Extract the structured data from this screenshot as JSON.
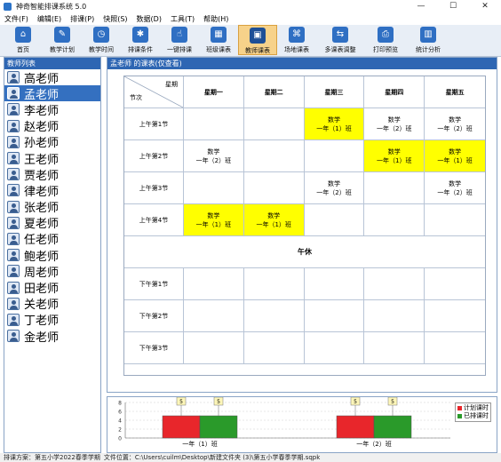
{
  "window": {
    "title": "神奇智能排课系统 5.0",
    "controls": [
      "—",
      "☐",
      "✕"
    ]
  },
  "menu": [
    "文件(F)",
    "编辑(E)",
    "排课(P)",
    "快照(S)",
    "数据(D)",
    "工具(T)",
    "帮助(H)"
  ],
  "toolbar": [
    {
      "label": "首页",
      "icon": "home-icon",
      "glyph": "⌂",
      "width": 44
    },
    {
      "label": "教学计划",
      "icon": "clipboard-icon",
      "glyph": "✎",
      "width": 44
    },
    {
      "label": "教学时间",
      "icon": "clock-icon",
      "glyph": "◷",
      "width": 44
    },
    {
      "label": "排课条件",
      "icon": "conditions-icon",
      "glyph": "✱",
      "width": 44
    },
    {
      "label": "一键排课",
      "icon": "hand-icon",
      "glyph": "☝",
      "width": 44
    },
    {
      "label": "班级课表",
      "icon": "calendar-icon",
      "glyph": "▦",
      "width": 44
    },
    {
      "label": "教师课表",
      "icon": "teacher-table-icon",
      "glyph": "▣",
      "width": 44,
      "active": true
    },
    {
      "label": "场地课表",
      "icon": "venue-icon",
      "glyph": "⌘",
      "width": 44
    },
    {
      "label": "多课表调整",
      "icon": "multi-adjust-icon",
      "glyph": "⇆",
      "width": 54
    },
    {
      "label": "打印预览",
      "icon": "printer-icon",
      "glyph": "⎙",
      "width": 48
    },
    {
      "label": "统计分析",
      "icon": "chart-icon",
      "glyph": "▥",
      "width": 48
    }
  ],
  "teacher_list": {
    "header": "教师列表",
    "teachers": [
      "高老师",
      "孟老师",
      "李老师",
      "赵老师",
      "孙老师",
      "王老师",
      "贾老师",
      "律老师",
      "张老师",
      "夏老师",
      "任老师",
      "鲍老师",
      "周老师",
      "田老师",
      "关老师",
      "丁老师",
      "金老师"
    ],
    "selected_index": 1
  },
  "schedule": {
    "panel_title": "孟老师 的课表(仅查看)",
    "corner_top": "星期",
    "corner_bottom": "节次",
    "days": [
      "星期一",
      "星期二",
      "星期三",
      "星期四",
      "星期五"
    ],
    "lunch_label": "午休",
    "periods": [
      {
        "label": "上午第1节",
        "cells": [
          null,
          null,
          {
            "line1": "数学",
            "line2": "一年（1）班",
            "highlight": true
          },
          {
            "line1": "数学",
            "line2": "一年（2）班"
          },
          {
            "line1": "数学",
            "line2": "一年（2）班"
          }
        ]
      },
      {
        "label": "上午第2节",
        "cells": [
          {
            "line1": "数学",
            "line2": "一年（2）班"
          },
          null,
          null,
          {
            "line1": "数学",
            "line2": "一年（1）班",
            "highlight": true
          },
          {
            "line1": "数学",
            "line2": "一年（1）班",
            "highlight": true
          }
        ]
      },
      {
        "label": "上午第3节",
        "cells": [
          null,
          null,
          {
            "line1": "数学",
            "line2": "一年（2）班"
          },
          null,
          {
            "line1": "数学",
            "line2": "一年（2）班"
          }
        ]
      },
      {
        "label": "上午第4节",
        "cells": [
          {
            "line1": "数学",
            "line2": "一年（1）班",
            "highlight": true
          },
          {
            "line1": "数学",
            "line2": "一年（1）班",
            "highlight": true
          },
          null,
          null,
          null
        ]
      },
      {
        "label": "下午第1节",
        "cells": [
          null,
          null,
          null,
          null,
          null
        ]
      },
      {
        "label": "下午第2节",
        "cells": [
          null,
          null,
          null,
          null,
          null
        ]
      },
      {
        "label": "下午第3节",
        "cells": [
          null,
          null,
          null,
          null,
          null
        ]
      }
    ]
  },
  "stats_chart": {
    "legend": [
      {
        "label": "计划课时",
        "color": "#e8262b"
      },
      {
        "label": "已排课时",
        "color": "#2a9a2a"
      }
    ],
    "y_ticks": [
      "8",
      "6",
      "4",
      "2",
      "0"
    ],
    "groups": [
      {
        "class": "一年（1）班",
        "planned": 5,
        "scheduled": 5
      },
      {
        "class": "一年（2）班",
        "planned": 5,
        "scheduled": 5
      }
    ]
  },
  "status": {
    "plan": "排课方案：第五小学2022春季学期",
    "file": "文件位置：C:\\Users\\cuilm\\Desktop\\新建文件夹 (3)\\第五小学春季学期.sqpk"
  }
}
